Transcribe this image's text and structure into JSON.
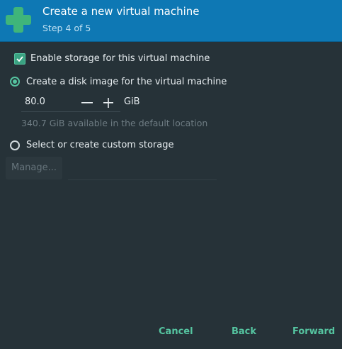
{
  "header": {
    "title": "Create a new virtual machine",
    "step": "Step 4 of 5",
    "icon": "plus-icon",
    "icon_color": "#3fb57a",
    "background": "#0e78b4"
  },
  "storage": {
    "enable_label": "Enable storage for this virtual machine",
    "enable_checked": true,
    "disk_image_label": "Create a disk image for the virtual machine",
    "disk_image_selected": true,
    "size_value": "80.0",
    "size_unit": "GiB",
    "available_text": "340.7 GiB available in the default location",
    "custom_label": "Select or create custom storage",
    "custom_selected": false,
    "manage_label": "Manage..."
  },
  "footer": {
    "cancel_label": "Cancel",
    "back_label": "Back",
    "forward_label": "Forward"
  },
  "colors": {
    "accent": "#55c4a0",
    "background": "#263238"
  }
}
